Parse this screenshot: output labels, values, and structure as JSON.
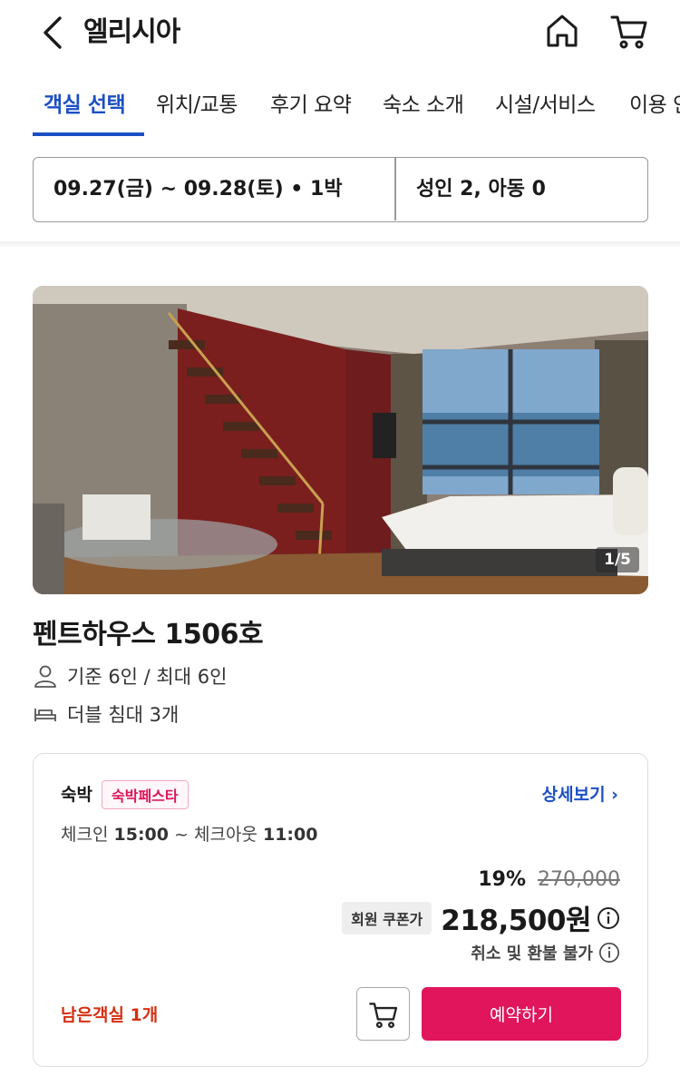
{
  "header": {
    "title": "엘리시아",
    "icons": {
      "back": "chevron-left-icon",
      "home": "home-icon",
      "cart": "cart-icon"
    }
  },
  "tabs": [
    {
      "label": "객실 선택",
      "active": true
    },
    {
      "label": "위치/교통",
      "active": false
    },
    {
      "label": "후기 요약",
      "active": false
    },
    {
      "label": "숙소 소개",
      "active": false
    },
    {
      "label": "시설/서비스",
      "active": false
    },
    {
      "label": "이용 안",
      "active": false
    }
  ],
  "search": {
    "dates": "09.27(금) ~ 09.28(토) • 1박",
    "guests": "성인 2, 아동 0"
  },
  "photo": {
    "counter": "1/5"
  },
  "room": {
    "name": "펜트하우스 1506호",
    "capacity": "기준 6인 / 최대 6인",
    "beds": "더블 침대 3개"
  },
  "offer": {
    "stay_type": "숙박",
    "promo_tag": "숙박페스타",
    "detail_link": "상세보기 ›",
    "checkin_label": "체크인",
    "checkin_time": "15:00",
    "checkout_label": "~ 체크아웃",
    "checkout_time": "11:00",
    "discount_pct": "19%",
    "original_price": "270,000",
    "coupon_tag": "회원 쿠폰가",
    "price": "218,500원",
    "refund_note": "취소 및 환불 불가",
    "remaining": "남은객실 1개",
    "book_label": "예약하기"
  },
  "colors": {
    "accent": "#1b4fc4",
    "book": "#e0155c",
    "remaining": "#d62f12",
    "promo": "#e0145a"
  }
}
